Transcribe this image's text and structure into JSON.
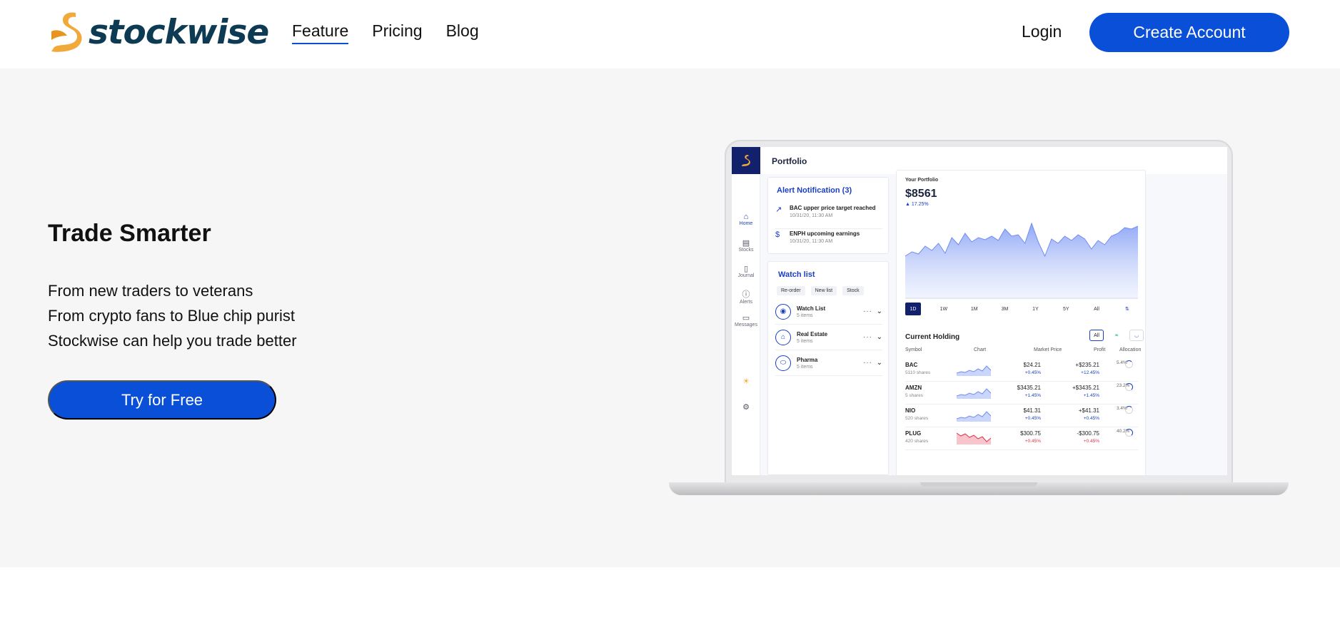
{
  "brand": {
    "name": "stockwise"
  },
  "nav": {
    "links": [
      {
        "label": "Feature",
        "active": true
      },
      {
        "label": "Pricing"
      },
      {
        "label": "Blog"
      }
    ],
    "login": "Login",
    "create_account": "Create Account"
  },
  "hero": {
    "title": "Trade Smarter",
    "lines": [
      "From new traders to veterans",
      "From crypto fans to Blue chip purist",
      "Stockwise can help you trade better"
    ],
    "cta": "Try for Free"
  },
  "colors": {
    "primary": "#0a4fd8",
    "brand_text": "#0d3b54",
    "logo_accent": "#f2a93b",
    "hero_bg": "#f6f6f6",
    "app_navy": "#13206b",
    "negative": "#e2334a"
  },
  "app": {
    "header_title": "Portfolio",
    "sidebar": [
      {
        "label": "Home",
        "icon": "home-icon",
        "active": true
      },
      {
        "label": "Stocks",
        "icon": "stocks-icon"
      },
      {
        "label": "Journal",
        "icon": "journal-icon"
      },
      {
        "label": "Alerts",
        "icon": "alert-icon"
      },
      {
        "label": "Messages",
        "icon": "message-icon"
      }
    ],
    "alerts": {
      "title": "Alert Notification (3)",
      "items": [
        {
          "text": "BAC upper price target reached",
          "time": "10/31/20, 11:30 AM",
          "icon": "arrow-up-right-icon"
        },
        {
          "text": "ENPH upcoming earnings",
          "time": "10/31/20, 11:30 AM",
          "icon": "dollar-cycle-icon"
        }
      ]
    },
    "watchlist": {
      "title": "Watch list",
      "tools": [
        "Re-order",
        "New list",
        "Stock"
      ],
      "items": [
        {
          "name": "Watch List",
          "count": "5 items",
          "icon": "eye-icon"
        },
        {
          "name": "Real Estate",
          "count": "5 items",
          "icon": "building-icon"
        },
        {
          "name": "Pharma",
          "count": "5 items",
          "icon": "pill-icon"
        }
      ]
    },
    "portfolio": {
      "label": "Your Portfolio",
      "value": "$8561",
      "change": "▲ 17.25%",
      "ranges": [
        "1D",
        "1W",
        "1M",
        "3M",
        "1Y",
        "5Y",
        "All"
      ],
      "active_range": "1D",
      "spark": [
        58,
        52,
        55,
        44,
        50,
        40,
        54,
        32,
        42,
        26,
        38,
        32,
        35,
        30,
        36,
        20,
        30,
        28,
        40,
        12,
        38,
        58,
        34,
        40,
        30,
        36,
        28,
        34,
        48,
        36,
        42,
        30,
        26,
        18,
        20,
        16
      ]
    },
    "holdings": {
      "title": "Current Holding",
      "filters": [
        "All"
      ],
      "columns": [
        "Symbol",
        "Chart",
        "Market Price",
        "Profit",
        "Allocation"
      ],
      "rows": [
        {
          "symbol": "BAC",
          "shares": "5110 shares",
          "price": "$24.21",
          "price_change": "+0.45%",
          "profit": "+$235.21",
          "profit_change": "+12.45%",
          "allocation": "5.4%",
          "trend": "up"
        },
        {
          "symbol": "AMZN",
          "shares": "5 shares",
          "price": "$3435.21",
          "price_change": "+1.45%",
          "profit": "+$3435.21",
          "profit_change": "+1.45%",
          "allocation": "23.2%",
          "trend": "up"
        },
        {
          "symbol": "NIO",
          "shares": "520 shares",
          "price": "$41.31",
          "price_change": "+0.45%",
          "profit": "+$41.31",
          "profit_change": "+0.45%",
          "allocation": "3.4%",
          "trend": "up"
        },
        {
          "symbol": "PLUG",
          "shares": "420 shares",
          "price": "$300.75",
          "price_change": "+0.45%",
          "profit": "-$300.75",
          "profit_change": "+0.45%",
          "allocation": "40.2%",
          "trend": "down"
        }
      ]
    }
  }
}
